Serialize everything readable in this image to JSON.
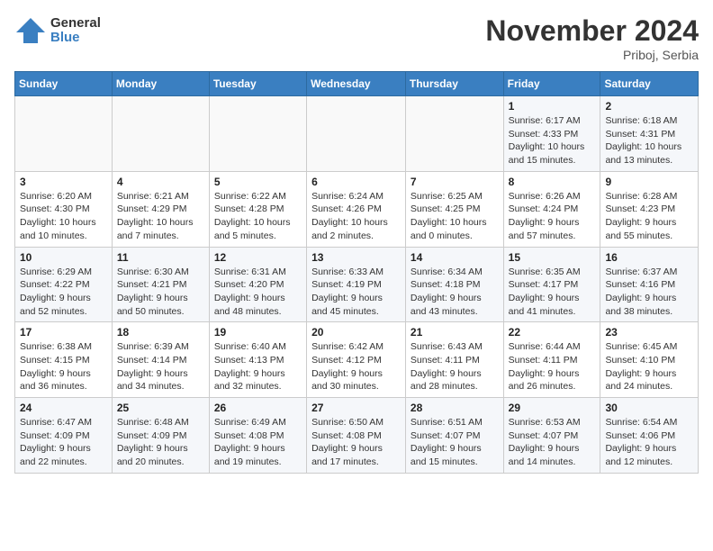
{
  "logo": {
    "general": "General",
    "blue": "Blue"
  },
  "title": "November 2024",
  "location": "Priboj, Serbia",
  "days_header": [
    "Sunday",
    "Monday",
    "Tuesday",
    "Wednesday",
    "Thursday",
    "Friday",
    "Saturday"
  ],
  "weeks": [
    [
      {
        "day": "",
        "info": ""
      },
      {
        "day": "",
        "info": ""
      },
      {
        "day": "",
        "info": ""
      },
      {
        "day": "",
        "info": ""
      },
      {
        "day": "",
        "info": ""
      },
      {
        "day": "1",
        "info": "Sunrise: 6:17 AM\nSunset: 4:33 PM\nDaylight: 10 hours and 15 minutes."
      },
      {
        "day": "2",
        "info": "Sunrise: 6:18 AM\nSunset: 4:31 PM\nDaylight: 10 hours and 13 minutes."
      }
    ],
    [
      {
        "day": "3",
        "info": "Sunrise: 6:20 AM\nSunset: 4:30 PM\nDaylight: 10 hours and 10 minutes."
      },
      {
        "day": "4",
        "info": "Sunrise: 6:21 AM\nSunset: 4:29 PM\nDaylight: 10 hours and 7 minutes."
      },
      {
        "day": "5",
        "info": "Sunrise: 6:22 AM\nSunset: 4:28 PM\nDaylight: 10 hours and 5 minutes."
      },
      {
        "day": "6",
        "info": "Sunrise: 6:24 AM\nSunset: 4:26 PM\nDaylight: 10 hours and 2 minutes."
      },
      {
        "day": "7",
        "info": "Sunrise: 6:25 AM\nSunset: 4:25 PM\nDaylight: 10 hours and 0 minutes."
      },
      {
        "day": "8",
        "info": "Sunrise: 6:26 AM\nSunset: 4:24 PM\nDaylight: 9 hours and 57 minutes."
      },
      {
        "day": "9",
        "info": "Sunrise: 6:28 AM\nSunset: 4:23 PM\nDaylight: 9 hours and 55 minutes."
      }
    ],
    [
      {
        "day": "10",
        "info": "Sunrise: 6:29 AM\nSunset: 4:22 PM\nDaylight: 9 hours and 52 minutes."
      },
      {
        "day": "11",
        "info": "Sunrise: 6:30 AM\nSunset: 4:21 PM\nDaylight: 9 hours and 50 minutes."
      },
      {
        "day": "12",
        "info": "Sunrise: 6:31 AM\nSunset: 4:20 PM\nDaylight: 9 hours and 48 minutes."
      },
      {
        "day": "13",
        "info": "Sunrise: 6:33 AM\nSunset: 4:19 PM\nDaylight: 9 hours and 45 minutes."
      },
      {
        "day": "14",
        "info": "Sunrise: 6:34 AM\nSunset: 4:18 PM\nDaylight: 9 hours and 43 minutes."
      },
      {
        "day": "15",
        "info": "Sunrise: 6:35 AM\nSunset: 4:17 PM\nDaylight: 9 hours and 41 minutes."
      },
      {
        "day": "16",
        "info": "Sunrise: 6:37 AM\nSunset: 4:16 PM\nDaylight: 9 hours and 38 minutes."
      }
    ],
    [
      {
        "day": "17",
        "info": "Sunrise: 6:38 AM\nSunset: 4:15 PM\nDaylight: 9 hours and 36 minutes."
      },
      {
        "day": "18",
        "info": "Sunrise: 6:39 AM\nSunset: 4:14 PM\nDaylight: 9 hours and 34 minutes."
      },
      {
        "day": "19",
        "info": "Sunrise: 6:40 AM\nSunset: 4:13 PM\nDaylight: 9 hours and 32 minutes."
      },
      {
        "day": "20",
        "info": "Sunrise: 6:42 AM\nSunset: 4:12 PM\nDaylight: 9 hours and 30 minutes."
      },
      {
        "day": "21",
        "info": "Sunrise: 6:43 AM\nSunset: 4:11 PM\nDaylight: 9 hours and 28 minutes."
      },
      {
        "day": "22",
        "info": "Sunrise: 6:44 AM\nSunset: 4:11 PM\nDaylight: 9 hours and 26 minutes."
      },
      {
        "day": "23",
        "info": "Sunrise: 6:45 AM\nSunset: 4:10 PM\nDaylight: 9 hours and 24 minutes."
      }
    ],
    [
      {
        "day": "24",
        "info": "Sunrise: 6:47 AM\nSunset: 4:09 PM\nDaylight: 9 hours and 22 minutes."
      },
      {
        "day": "25",
        "info": "Sunrise: 6:48 AM\nSunset: 4:09 PM\nDaylight: 9 hours and 20 minutes."
      },
      {
        "day": "26",
        "info": "Sunrise: 6:49 AM\nSunset: 4:08 PM\nDaylight: 9 hours and 19 minutes."
      },
      {
        "day": "27",
        "info": "Sunrise: 6:50 AM\nSunset: 4:08 PM\nDaylight: 9 hours and 17 minutes."
      },
      {
        "day": "28",
        "info": "Sunrise: 6:51 AM\nSunset: 4:07 PM\nDaylight: 9 hours and 15 minutes."
      },
      {
        "day": "29",
        "info": "Sunrise: 6:53 AM\nSunset: 4:07 PM\nDaylight: 9 hours and 14 minutes."
      },
      {
        "day": "30",
        "info": "Sunrise: 6:54 AM\nSunset: 4:06 PM\nDaylight: 9 hours and 12 minutes."
      }
    ]
  ]
}
